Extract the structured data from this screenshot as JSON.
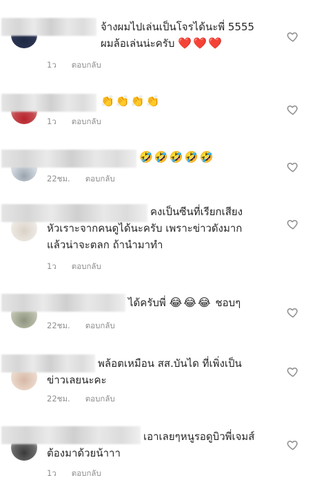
{
  "reply_label": "ตอบกลับ",
  "colors": {
    "text": "#262626",
    "meta": "#8e8e8e",
    "heart_outline": "#8e8e8e"
  },
  "comments": [
    {
      "line1": "จ้างผมไปเล่นเป็นโจรได้นะพี่ 5555",
      "line2": "ผมล้อเล่นน่ะครับ",
      "emoji": "❤️❤️❤️",
      "time": "1ว"
    },
    {
      "line1": "",
      "line2": "",
      "emoji": "👏👏👏👏",
      "time": "1ว"
    },
    {
      "line1": "",
      "line2": "",
      "emoji": "🤣🤣🤣🤣🤣",
      "time": "22ชม."
    },
    {
      "line1": "คงเป็นซีนที่เรียกเสียง",
      "line2": "หัวเราะจากคนดูได้นะครับ  เพราะข่าวดังมาก",
      "line3": "แล้วน่าจะตลก ถ้านำมาทำ",
      "time": "1ว"
    },
    {
      "line1": "ได้ครับพี่",
      "emoji": "😂😂😂",
      "line1b": "ชอบๆ",
      "time": "22ชม."
    },
    {
      "line1": "พล้อตเหมือน สส.บันได ที่เพิ่งเป็น",
      "line2": "ข่าวเลยนะคะ",
      "time": "22ชม."
    },
    {
      "line1": "เอาเลยๆหนูรอดูบิวพี่เจมส์",
      "line2": "ต้องมาด้วยน้าาา",
      "time": "1ว"
    }
  ]
}
